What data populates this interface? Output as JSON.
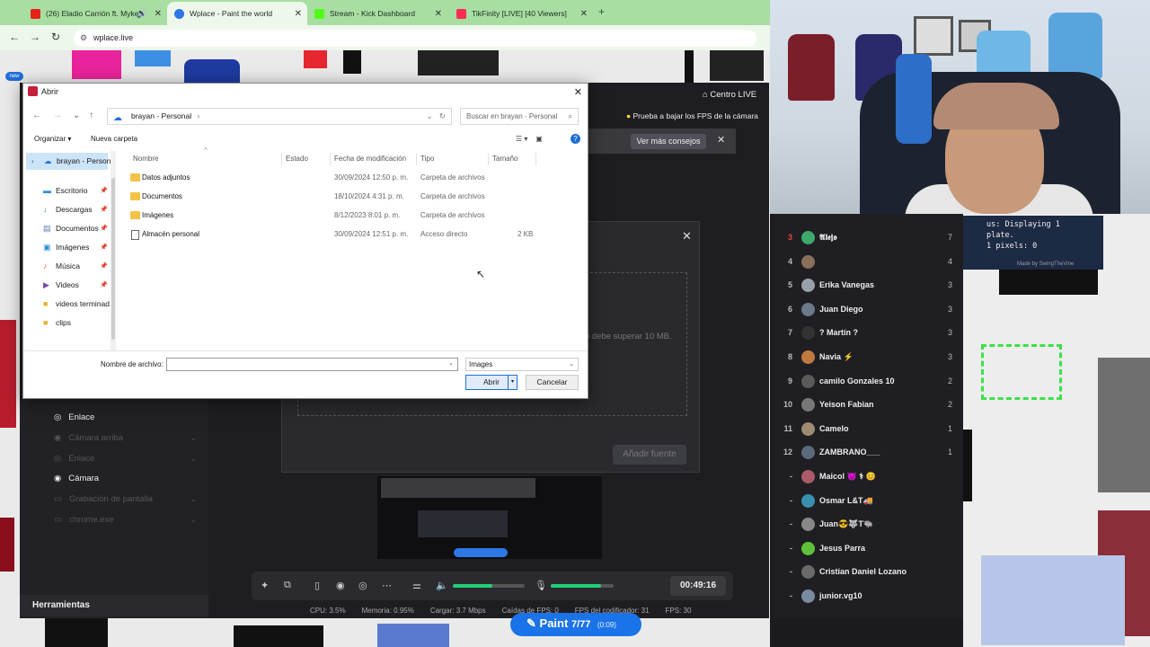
{
  "browser": {
    "tabs": [
      {
        "title": "(26) Eladio Carrión ft. Myke",
        "color": "#e62117"
      },
      {
        "title": "Wplace - Paint the world",
        "color": "#2b78e4"
      },
      {
        "title": "Stream - Kick Dashboard",
        "color": "#53fc18"
      },
      {
        "title": "TikFinity [LIVE] [40 Viewers]",
        "color": "#fe2c55"
      }
    ],
    "url": "wplace.live",
    "new_badge": "new"
  },
  "obs": {
    "centro_live": "Centro LIVE",
    "tip": "Prueba a bajar los FPS de la cámara",
    "more_tips": "Ver más consejos",
    "add_dialog": {
      "note": "o debe superar 10 MB.",
      "add_button": "Añadir fuente"
    },
    "sources": [
      {
        "label": "Enlace",
        "enabled": true
      },
      {
        "label": "Cámara arriba",
        "enabled": false
      },
      {
        "label": "Enlace",
        "enabled": false
      },
      {
        "label": "Cámara",
        "enabled": true
      },
      {
        "label": "Grabación de pantalla",
        "enabled": false
      },
      {
        "label": "chrome.exe",
        "enabled": false
      }
    ],
    "tools_label": "Herramientas",
    "timer": "00:49:16",
    "meters": {
      "speaker": 0.55,
      "mic": 0.8
    },
    "status": {
      "cpu": "CPU: 3.5%",
      "memory": "Memoria: 0.95%",
      "upload": "Cargar: 3.7 Mbps",
      "dropped": "Caídas de FPS: 0",
      "encoder": "FPS del codificador: 31",
      "fps": "FPS: 30"
    }
  },
  "paint_button": {
    "label": "Paint",
    "count": "7/77",
    "time": "(0:09)"
  },
  "file_dialog": {
    "title": "Abrir",
    "path_root": "brayan - Personal",
    "search_placeholder": "Buscar en brayan - Personal",
    "organize": "Organizar",
    "new_folder": "Nueva carpeta",
    "nav": [
      {
        "label": "brayan - Person",
        "icon": "cloud"
      },
      {
        "label": "Escritorio",
        "icon": "desktop"
      },
      {
        "label": "Descargas",
        "icon": "download"
      },
      {
        "label": "Documentos",
        "icon": "documents"
      },
      {
        "label": "Imágenes",
        "icon": "images"
      },
      {
        "label": "Música",
        "icon": "music"
      },
      {
        "label": "Videos",
        "icon": "videos"
      },
      {
        "label": "videos terminad",
        "icon": "folder"
      },
      {
        "label": "clips",
        "icon": "folder"
      }
    ],
    "columns": {
      "name": "Nombre",
      "status": "Estado",
      "modified": "Fecha de modificación",
      "type": "Tipo",
      "size": "Tamaño"
    },
    "files": [
      {
        "name": "Datos adjuntos",
        "modified": "30/09/2024 12:50 p. m.",
        "type": "Carpeta de archivos",
        "size": "",
        "kind": "folder"
      },
      {
        "name": "Documentos",
        "modified": "18/10/2024 4:31 p. m.",
        "type": "Carpeta de archivos",
        "size": "",
        "kind": "folder"
      },
      {
        "name": "Imágenes",
        "modified": "8/12/2023 8:01 p. m.",
        "type": "Carpeta de archivos",
        "size": "",
        "kind": "folder"
      },
      {
        "name": "Almacén personal",
        "modified": "30/09/2024 12:51 p. m.",
        "type": "Acceso directo",
        "size": "2 KB",
        "kind": "shortcut"
      }
    ],
    "filename_label": "Nombre de archivo:",
    "filename_value": "",
    "filter": "Images",
    "open_button": "Abrir",
    "cancel_button": "Cancelar"
  },
  "viewers": [
    {
      "rank": "3",
      "name": "𝕬𝖑𝖊𝖏𝖔",
      "count": "7",
      "top": true
    },
    {
      "rank": "4",
      "name": "",
      "count": "4",
      "top": false
    },
    {
      "rank": "5",
      "name": "Erika Vanegas",
      "count": "3",
      "top": false
    },
    {
      "rank": "6",
      "name": "Juan Diego",
      "count": "3",
      "top": false
    },
    {
      "rank": "7",
      "name": "? Martín ?",
      "count": "3",
      "top": false
    },
    {
      "rank": "8",
      "name": "Navia ⚡",
      "count": "3",
      "top": false
    },
    {
      "rank": "9",
      "name": "camilo Gonzales 10",
      "count": "2",
      "top": false
    },
    {
      "rank": "10",
      "name": "Yeison Fabian",
      "count": "2",
      "top": false
    },
    {
      "rank": "11",
      "name": "Camelo",
      "count": "1",
      "top": false
    },
    {
      "rank": "12",
      "name": "ZAMBRANO___",
      "count": "1",
      "top": false
    },
    {
      "rank": "-",
      "name": "Maicol 😈 ⚕ 😊",
      "count": "",
      "top": false
    },
    {
      "rank": "-",
      "name": "Osmar L&T🚚",
      "count": "",
      "top": false
    },
    {
      "rank": "-",
      "name": "Juan😎🐺T🐃",
      "count": "",
      "top": false
    },
    {
      "rank": "-",
      "name": "Jesus Parra",
      "count": "",
      "top": false
    },
    {
      "rank": "-",
      "name": "Cristian Daniel Lozano",
      "count": "",
      "top": false
    },
    {
      "rank": "-",
      "name": "junior.vg10",
      "count": "",
      "top": false
    }
  ],
  "overlay": {
    "line1": "us: Displaying 1",
    "line2": "plate.",
    "line3": "1 pixels: 0",
    "credit": "Made by SwingTheVine"
  }
}
